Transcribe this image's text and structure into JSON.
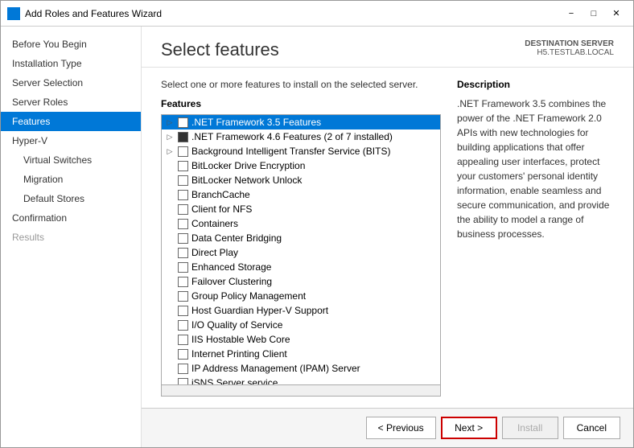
{
  "titlebar": {
    "title": "Add Roles and Features Wizard",
    "icon": "wizard-icon",
    "min": "−",
    "max": "□",
    "close": "✕"
  },
  "server": {
    "label": "DESTINATION SERVER",
    "name": "H5.TESTLAB.LOCAL"
  },
  "page": {
    "title": "Select features",
    "instruction": "Select one or more features to install on the selected server."
  },
  "sidebar": {
    "items": [
      {
        "id": "before-you-begin",
        "label": "Before You Begin",
        "indent": 0,
        "active": false,
        "disabled": false
      },
      {
        "id": "installation-type",
        "label": "Installation Type",
        "indent": 0,
        "active": false,
        "disabled": false
      },
      {
        "id": "server-selection",
        "label": "Server Selection",
        "indent": 0,
        "active": false,
        "disabled": false
      },
      {
        "id": "server-roles",
        "label": "Server Roles",
        "indent": 0,
        "active": false,
        "disabled": false
      },
      {
        "id": "features",
        "label": "Features",
        "indent": 0,
        "active": true,
        "disabled": false
      },
      {
        "id": "hyper-v",
        "label": "Hyper-V",
        "indent": 0,
        "active": false,
        "disabled": false
      },
      {
        "id": "virtual-switches",
        "label": "Virtual Switches",
        "indent": 1,
        "active": false,
        "disabled": false
      },
      {
        "id": "migration",
        "label": "Migration",
        "indent": 1,
        "active": false,
        "disabled": false
      },
      {
        "id": "default-stores",
        "label": "Default Stores",
        "indent": 1,
        "active": false,
        "disabled": false
      },
      {
        "id": "confirmation",
        "label": "Confirmation",
        "indent": 0,
        "active": false,
        "disabled": false
      },
      {
        "id": "results",
        "label": "Results",
        "indent": 0,
        "active": false,
        "disabled": true
      }
    ]
  },
  "features_section": {
    "label": "Features"
  },
  "features": [
    {
      "id": "net35",
      "label": ".NET Framework 3.5 Features",
      "indent": 0,
      "expandable": true,
      "checked": false,
      "selected": true
    },
    {
      "id": "net46",
      "label": ".NET Framework 4.6 Features (2 of 7 installed)",
      "indent": 0,
      "expandable": true,
      "checked": true,
      "partial": true,
      "selected": false
    },
    {
      "id": "bits",
      "label": "Background Intelligent Transfer Service (BITS)",
      "indent": 0,
      "expandable": true,
      "checked": false,
      "selected": false
    },
    {
      "id": "bitlocker",
      "label": "BitLocker Drive Encryption",
      "indent": 0,
      "expandable": false,
      "checked": false,
      "selected": false
    },
    {
      "id": "bitlocker-unlock",
      "label": "BitLocker Network Unlock",
      "indent": 0,
      "expandable": false,
      "checked": false,
      "selected": false
    },
    {
      "id": "branchcache",
      "label": "BranchCache",
      "indent": 0,
      "expandable": false,
      "checked": false,
      "selected": false
    },
    {
      "id": "client-nfs",
      "label": "Client for NFS",
      "indent": 0,
      "expandable": false,
      "checked": false,
      "selected": false
    },
    {
      "id": "containers",
      "label": "Containers",
      "indent": 0,
      "expandable": false,
      "checked": false,
      "selected": false
    },
    {
      "id": "data-center-bridging",
      "label": "Data Center Bridging",
      "indent": 0,
      "expandable": false,
      "checked": false,
      "selected": false
    },
    {
      "id": "direct-play",
      "label": "Direct Play",
      "indent": 0,
      "expandable": false,
      "checked": false,
      "selected": false
    },
    {
      "id": "enhanced-storage",
      "label": "Enhanced Storage",
      "indent": 0,
      "expandable": false,
      "checked": false,
      "selected": false
    },
    {
      "id": "failover-clustering",
      "label": "Failover Clustering",
      "indent": 0,
      "expandable": false,
      "checked": false,
      "selected": false
    },
    {
      "id": "group-policy",
      "label": "Group Policy Management",
      "indent": 0,
      "expandable": false,
      "checked": false,
      "selected": false
    },
    {
      "id": "host-guardian",
      "label": "Host Guardian Hyper-V Support",
      "indent": 0,
      "expandable": false,
      "checked": false,
      "selected": false
    },
    {
      "id": "io-qos",
      "label": "I/O Quality of Service",
      "indent": 0,
      "expandable": false,
      "checked": false,
      "selected": false
    },
    {
      "id": "iis-hostable",
      "label": "IIS Hostable Web Core",
      "indent": 0,
      "expandable": false,
      "checked": false,
      "selected": false
    },
    {
      "id": "internet-printing",
      "label": "Internet Printing Client",
      "indent": 0,
      "expandable": false,
      "checked": false,
      "selected": false
    },
    {
      "id": "ipam",
      "label": "IP Address Management (IPAM) Server",
      "indent": 0,
      "expandable": false,
      "checked": false,
      "selected": false
    },
    {
      "id": "isns",
      "label": "iSNS Server service",
      "indent": 0,
      "expandable": false,
      "checked": false,
      "selected": false
    }
  ],
  "description": {
    "label": "Description",
    "text": ".NET Framework 3.5 combines the power of the .NET Framework 2.0 APIs with new technologies for building applications that offer appealing user interfaces, protect your customers' personal identity information, enable seamless and secure communication, and provide the ability to model a range of business processes."
  },
  "footer": {
    "prev_label": "< Previous",
    "next_label": "Next >",
    "install_label": "Install",
    "cancel_label": "Cancel"
  }
}
